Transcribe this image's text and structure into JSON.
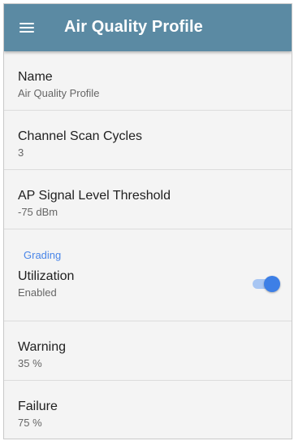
{
  "appbar": {
    "title": "Air Quality Profile",
    "menu_icon": "hamburger-menu-icon",
    "background": "#5b8aa3"
  },
  "settings": [
    {
      "label": "Name",
      "value": "Air Quality Profile"
    },
    {
      "label": "Channel Scan Cycles",
      "value": "3"
    },
    {
      "label": "AP Signal Level Threshold",
      "value": "-75 dBm"
    }
  ],
  "grading": {
    "header": "Grading",
    "header_color": "#4a86e8",
    "utilization": {
      "label": "Utilization",
      "value": "Enabled",
      "toggle_on": true
    },
    "warning": {
      "label": "Warning",
      "value": "35 %"
    },
    "failure": {
      "label": "Failure",
      "value": "75 %"
    }
  }
}
